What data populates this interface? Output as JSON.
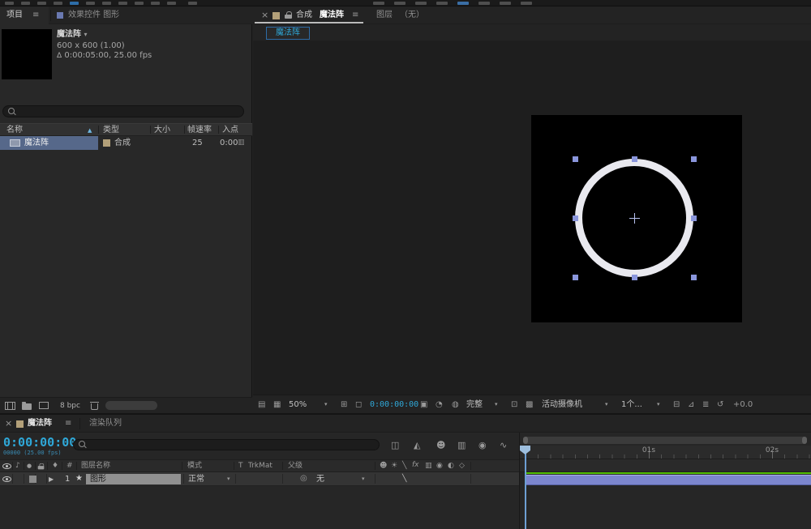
{
  "colors": {
    "accent_cyan": "#2fa8d8",
    "comp_label_tan": "#b3a079",
    "selection_blue": "#56688a",
    "layer_bar_blue": "#7c86ce",
    "render_green": "#52c000",
    "handle_blue": "#8a96dc"
  },
  "icons": {
    "close": "×",
    "menu": "≡",
    "caret": "▾",
    "sort_asc": "▲",
    "delta": "Δ",
    "expand": "▶",
    "star": "★",
    "pickwhip": "◎",
    "audio": "♪",
    "solo": "●",
    "label": "♦",
    "always_preview": "▤",
    "main_viewer": "▦",
    "grid_guides": "⊞",
    "mask_visibility": "◻",
    "snapshot": "▣",
    "show_snapshot": "◔",
    "channels": "◍",
    "roi": "⊡",
    "transparency_grid": "▩",
    "pixel_aspect": "⊟",
    "fast_preview": "⊿",
    "flowchart": "≣",
    "reset_exposure": "↺",
    "mini_flowchart": "◫",
    "draft_3d": "◭",
    "shy": "☻",
    "frame_blend": "▥",
    "motion_blur": "◉",
    "graph_editor": "∿",
    "collapse": "☀",
    "quality": "╲",
    "fx": "fx",
    "adjustment": "◐",
    "three_d": "◇",
    "chart": "▥"
  },
  "left_panel": {
    "tab_project": "项目",
    "tab_effect_controls": "效果控件 图形",
    "info": {
      "name": "魔法阵",
      "dimensions": "600 x 600 (1.00)",
      "duration": "0:00:05:00, 25.00 fps"
    },
    "columns": {
      "name": "名称",
      "type": "类型",
      "size": "大小",
      "frame_rate": "帧速率",
      "in_point": "入点"
    },
    "row": {
      "name": "魔法阵",
      "type": "合成",
      "frame_rate": "25",
      "in_point": "0:00"
    },
    "footer": {
      "bit_depth": "8 bpc"
    }
  },
  "viewer": {
    "tab_composition_label": "合成",
    "tab_composition_name": "魔法阵",
    "tab_layer_label": "图层",
    "tab_layer_value": "（无）",
    "comp_tab": "魔法阵",
    "toolbar": {
      "magnification": "50%",
      "timecode": "0:00:00:00",
      "resolution": "完整",
      "camera": "活动摄像机",
      "view_layout": "1个...",
      "exposure": "+0.0"
    }
  },
  "timeline": {
    "tab_comp": "魔法阵",
    "tab_render_queue": "渲染队列",
    "timecode": "0:00:00:00",
    "frame_info": "00000 (25.00 fps)",
    "columns": {
      "hash": "#",
      "layer_name": "图层名称",
      "mode": "模式",
      "t": "T",
      "trkmat": "TrkMat",
      "parent": "父级"
    },
    "layer": {
      "number": "1",
      "name": "图形",
      "mode": "正常",
      "parent": "无"
    },
    "ruler_labels": [
      "01s",
      "02s"
    ]
  }
}
